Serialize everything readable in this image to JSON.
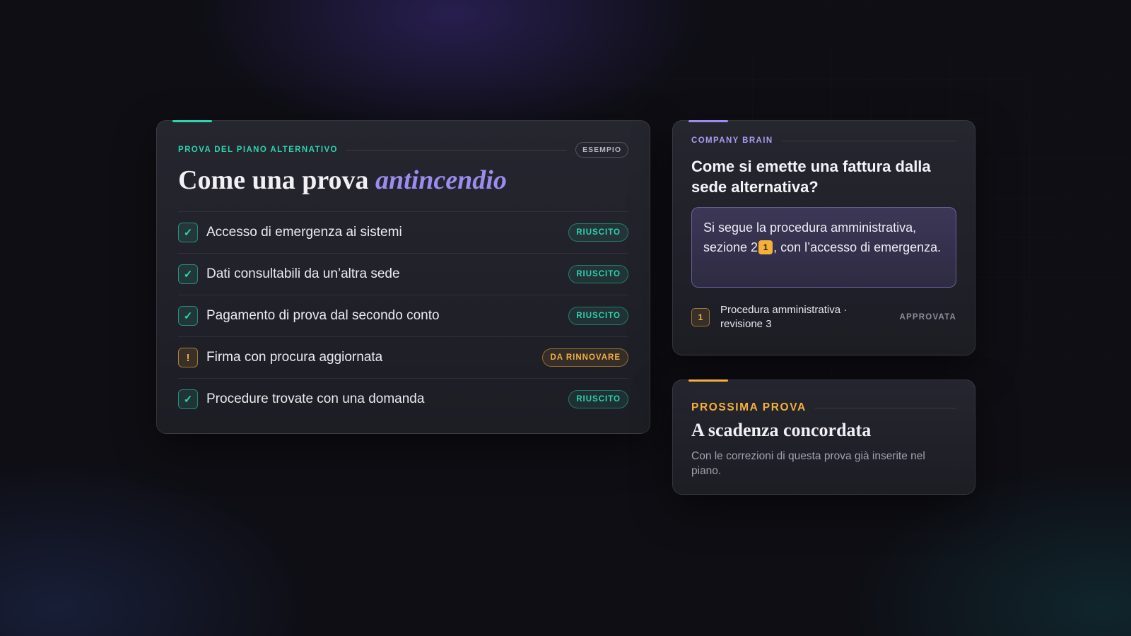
{
  "test_card": {
    "eyebrow": "PROVA DEL PIANO ALTERNATIVO",
    "badge": "ESEMPIO",
    "title_plain": "Come una prova",
    "title_accent": "antincendio",
    "items": [
      {
        "label": "Accesso di emergenza ai sistemi",
        "icon": "✓",
        "status": "RIUSCITO",
        "state": "ok"
      },
      {
        "label": "Dati consultabili da un’altra sede",
        "icon": "✓",
        "status": "RIUSCITO",
        "state": "ok"
      },
      {
        "label": "Pagamento di prova dal secondo conto",
        "icon": "✓",
        "status": "RIUSCITO",
        "state": "ok"
      },
      {
        "label": "Firma con procura aggiornata",
        "icon": "!",
        "status": "DA RINNOVARE",
        "state": "warn"
      },
      {
        "label": "Procedure trovate con una domanda",
        "icon": "✓",
        "status": "RIUSCITO",
        "state": "ok"
      }
    ]
  },
  "brain_card": {
    "eyebrow": "COMPANY BRAIN",
    "question": "Come si emette una fattura dalla sede alternativa?",
    "answer_before": "Si segue la procedura amministrativa, sezione 2",
    "answer_cite": "1",
    "answer_after": ", con l’accesso di emergenza.",
    "source": {
      "number": "1",
      "title": "Procedura amministrativa · revisione 3",
      "state": "APPROVATA"
    }
  },
  "next_card": {
    "eyebrow": "PROSSIMA PROVA",
    "title": "A scadenza concordata",
    "description": "Con le correzioni di questa prova già inserite nel piano."
  },
  "colors": {
    "teal": "#2ed3b0",
    "violet": "#9c8cf0",
    "amber": "#f5b03c",
    "background": "#0e0e14"
  }
}
